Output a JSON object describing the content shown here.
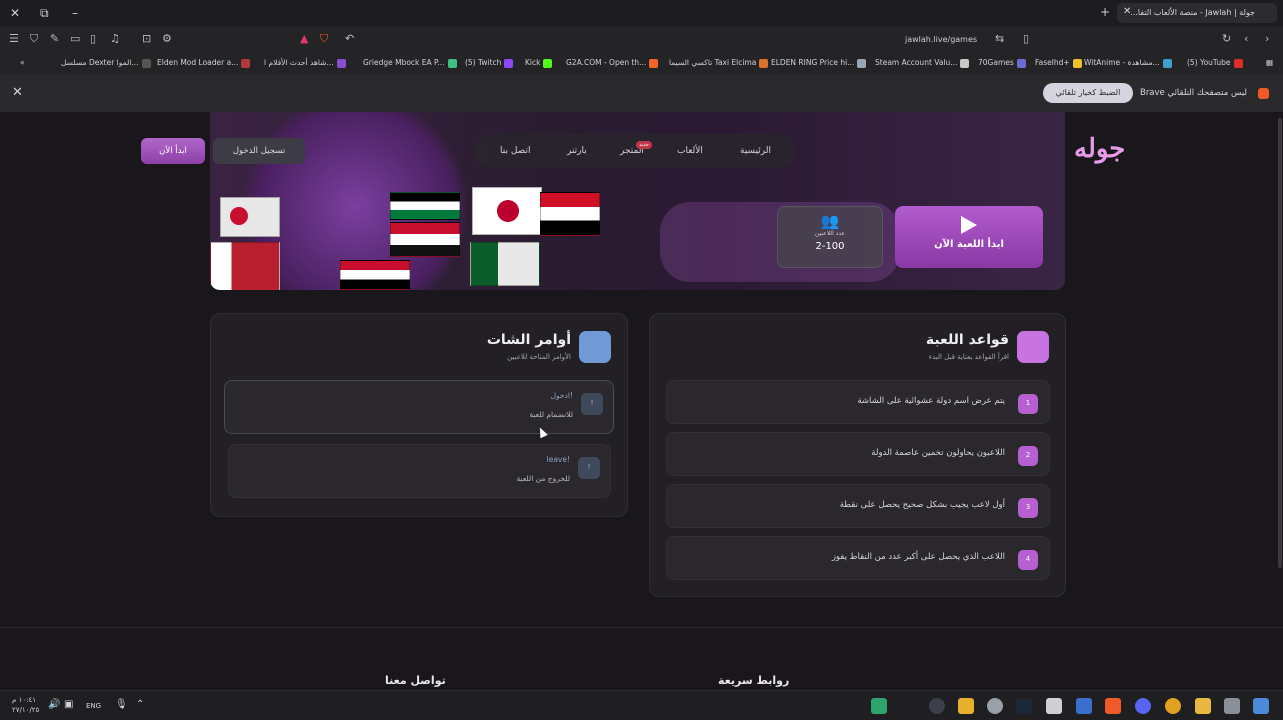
{
  "browser": {
    "tab_title": "جولة | Jawlah - منصة الألعاب التفا...",
    "url": "jawlah.live/games",
    "bookmarks": [
      {
        "label": "(5) YouTube",
        "color": "#e02b2b"
      },
      {
        "label": "WitAnime - مشاهدة...",
        "color": "#3f9fcf"
      },
      {
        "label": "Faselhd+",
        "color": "#f0c02a"
      },
      {
        "label": "70Games",
        "color": "#6b6bd6"
      },
      {
        "label": "Steam Account Valu...",
        "color": "#c8c8c8"
      },
      {
        "label": "ELDEN RING Price hi...",
        "color": "#9aa6b6"
      },
      {
        "label": "تاكسي السيما Taxi Elcima",
        "color": "#d8742a"
      },
      {
        "label": "G2A.COM - Open th...",
        "color": "#f26522"
      },
      {
        "label": "Kick",
        "color": "#53fc18"
      },
      {
        "label": "(5) Twitch",
        "color": "#9146ff"
      },
      {
        "label": "Griedge Mbock EA P...",
        "color": "#3fbf7f"
      },
      {
        "label": "شاهد أحدث الأفلام ا...",
        "color": "#8a4fd0"
      },
      {
        "label": "Elden Mod Loader a...",
        "color": "#b03a3a"
      },
      {
        "label": "مسلسل Dexter الموا...",
        "color": "#555"
      }
    ],
    "notification": {
      "text": "Brave ليس متصفحك التلقائي",
      "button": "الضبط كخيار تلقائي"
    }
  },
  "site": {
    "logo": "جوله",
    "nav": {
      "home": "الرئيسية",
      "games": "الألعاب",
      "store": "المتجر",
      "store_badge": "جديد",
      "partners": "بارتنر",
      "contact": "اتصل بنا"
    },
    "login_button": "تسجيل الدخول",
    "start_button": "ابدأ الآن"
  },
  "game": {
    "play_button": "ابدأ اللعبة الآن",
    "players_label": "عدد اللاعبين",
    "players_value": "2-100"
  },
  "rules": {
    "title": "قواعد اللعبة",
    "subtitle": "اقرأ القواعد بعناية قبل البدء",
    "items": [
      {
        "num": "1",
        "text": "يتم عرض اسم دولة عشوائية على الشاشة"
      },
      {
        "num": "2",
        "text": "اللاعبون يحاولون تخمين عاصمة الدولة"
      },
      {
        "num": "3",
        "text": "أول لاعب يجيب بشكل صحيح يحصل على نقطة"
      },
      {
        "num": "4",
        "text": "اللاعب الذي يحصل على أكبر عدد من النقاط يفوز"
      }
    ]
  },
  "commands": {
    "title": "أوامر الشات",
    "subtitle": "الأوامر المتاحة للاعبين",
    "items": [
      {
        "num": "!",
        "name": "ادخول!",
        "desc": "للانضمام للعبة"
      },
      {
        "num": "!",
        "name": "leave!",
        "desc": "للخروج من اللعبة"
      }
    ]
  },
  "footer": {
    "contact_heading": "تواصل معنا",
    "links_heading": "روابط سريعة"
  },
  "taskbar": {
    "lang": "ENG",
    "time": "١٠:٤١ م",
    "date": "٢٧/١٠/٢٥"
  }
}
